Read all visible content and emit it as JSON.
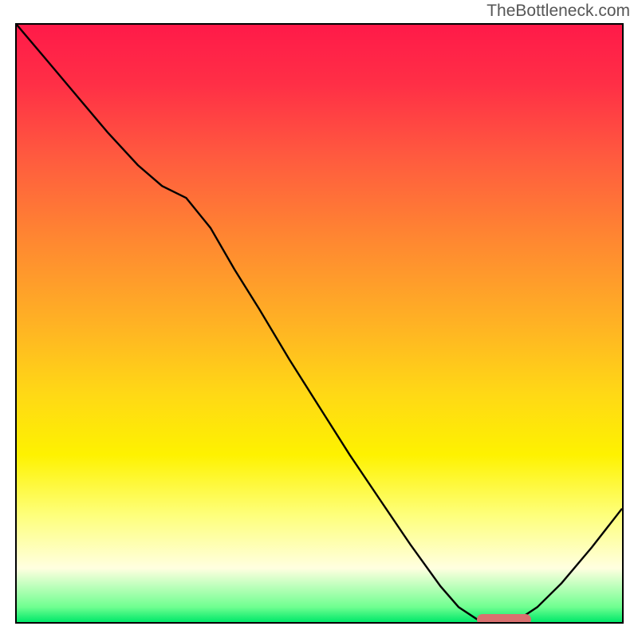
{
  "attribution": "TheBottleneck.com",
  "chart_data": {
    "type": "line",
    "x": [
      0,
      5,
      10,
      15,
      20,
      24,
      28,
      32,
      36,
      40,
      45,
      50,
      55,
      60,
      65,
      70,
      73,
      76,
      80,
      83,
      86,
      90,
      95,
      100
    ],
    "values": [
      100,
      94,
      88,
      82,
      76.5,
      73,
      71,
      66,
      59,
      52.5,
      44,
      36,
      28,
      20.5,
      13,
      6,
      2.5,
      0.5,
      0,
      0.5,
      2.5,
      6.5,
      12.5,
      19
    ],
    "title": "",
    "xlabel": "",
    "ylabel": "",
    "xlim": [
      0,
      100
    ],
    "ylim": [
      0,
      100
    ],
    "minimum_marker": {
      "x_start": 76,
      "x_end": 85,
      "y": 0
    },
    "gradient_stops": [
      {
        "pct": 0,
        "color": "#ff1a49"
      },
      {
        "pct": 10,
        "color": "#ff2f46"
      },
      {
        "pct": 22,
        "color": "#ff5a3f"
      },
      {
        "pct": 35,
        "color": "#ff8432"
      },
      {
        "pct": 50,
        "color": "#ffb224"
      },
      {
        "pct": 62,
        "color": "#ffd915"
      },
      {
        "pct": 72,
        "color": "#fef200"
      },
      {
        "pct": 82,
        "color": "#feff7a"
      },
      {
        "pct": 91,
        "color": "#ffffe0"
      },
      {
        "pct": 97.5,
        "color": "#6fff90"
      },
      {
        "pct": 100,
        "color": "#00e86a"
      }
    ]
  }
}
